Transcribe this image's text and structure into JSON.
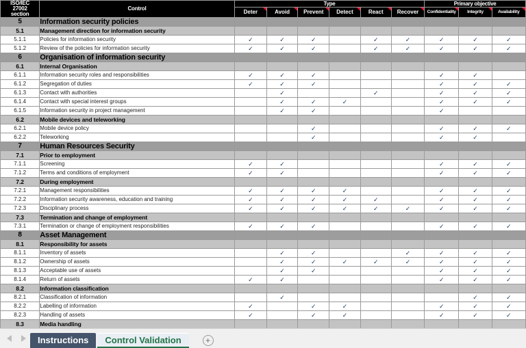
{
  "header": {
    "corner_lines": [
      "ISO/IEC",
      "27002",
      "section"
    ],
    "control_label": "Control",
    "type_label": "Type",
    "primary_objective_label": "Primary objective",
    "type_columns": [
      "Deter",
      "Avoid",
      "Prevent",
      "Detect",
      "React",
      "Recover"
    ],
    "objective_columns": [
      "Confidentiality",
      "Integrity",
      "Availability"
    ]
  },
  "checkmark_glyph": "✓",
  "colors": {
    "header_bg": "#000000",
    "header_text": "#ffffff",
    "level1_row_bg": "#9d9d9d",
    "level2_row_bg": "#c3c3c3",
    "item_row_bg": "#ffffff",
    "grid_line": "#9a9a9a",
    "comment_marker": "#e8112d",
    "active_tab_text": "#217346",
    "inactive_tab_bg": "#44546a"
  },
  "rows": [
    {
      "level": 1,
      "section": "5",
      "control": "Information security policies",
      "marks": [
        0,
        0,
        0,
        0,
        0,
        0,
        0,
        0,
        0
      ]
    },
    {
      "level": 2,
      "section": "5.1",
      "control": "Management direction for information security",
      "marks": [
        0,
        0,
        0,
        0,
        0,
        0,
        0,
        0,
        0
      ]
    },
    {
      "level": 3,
      "section": "5.1.1",
      "control": "Policies for information security",
      "marks": [
        1,
        1,
        1,
        0,
        1,
        1,
        1,
        1,
        1
      ]
    },
    {
      "level": 3,
      "section": "5.1.2",
      "control": "Review of the policies for information security",
      "marks": [
        1,
        1,
        1,
        0,
        1,
        1,
        1,
        1,
        1
      ]
    },
    {
      "level": 1,
      "section": "6",
      "control": "Organisation of information security",
      "marks": [
        0,
        0,
        0,
        0,
        0,
        0,
        0,
        0,
        0
      ]
    },
    {
      "level": 2,
      "section": "6.1",
      "control": "Internal Organisation",
      "marks": [
        0,
        0,
        0,
        0,
        0,
        0,
        0,
        0,
        0
      ]
    },
    {
      "level": 3,
      "section": "6.1.1",
      "control": "Information security roles and responsibilities",
      "marks": [
        1,
        1,
        1,
        0,
        0,
        0,
        1,
        1,
        0
      ]
    },
    {
      "level": 3,
      "section": "6.1.2",
      "control": "Segregation of duties",
      "marks": [
        1,
        1,
        1,
        0,
        0,
        0,
        1,
        1,
        1
      ]
    },
    {
      "level": 3,
      "section": "6.1.3",
      "control": "Contact with authorities",
      "marks": [
        0,
        1,
        0,
        0,
        1,
        0,
        1,
        1,
        1
      ]
    },
    {
      "level": 3,
      "section": "6.1.4",
      "control": "Contact with special interest groups",
      "marks": [
        0,
        1,
        1,
        1,
        0,
        0,
        1,
        1,
        1
      ]
    },
    {
      "level": 3,
      "section": "6.1.5",
      "control": "Information security in project management",
      "marks": [
        0,
        1,
        1,
        0,
        0,
        0,
        1,
        0,
        0
      ]
    },
    {
      "level": 2,
      "section": "6.2",
      "control": "Mobile devices and teleworking",
      "marks": [
        0,
        0,
        0,
        0,
        0,
        0,
        0,
        0,
        0
      ]
    },
    {
      "level": 3,
      "section": "6.2.1",
      "control": "Mobile device policy",
      "marks": [
        0,
        0,
        1,
        0,
        0,
        0,
        1,
        1,
        1
      ]
    },
    {
      "level": 3,
      "section": "6.2.2",
      "control": "Teleworking",
      "marks": [
        0,
        0,
        1,
        0,
        0,
        0,
        1,
        1,
        0
      ]
    },
    {
      "level": 1,
      "section": "7",
      "control": "Human Resources Security",
      "marks": [
        0,
        0,
        0,
        0,
        0,
        0,
        0,
        0,
        0
      ]
    },
    {
      "level": 2,
      "section": "7.1",
      "control": "Prior to employment",
      "marks": [
        0,
        0,
        0,
        0,
        0,
        0,
        0,
        0,
        0
      ]
    },
    {
      "level": 3,
      "section": "7.1.1",
      "control": "Screening",
      "marks": [
        1,
        1,
        0,
        0,
        0,
        0,
        1,
        1,
        1
      ]
    },
    {
      "level": 3,
      "section": "7.1.2",
      "control": "Terms and conditions of employment",
      "marks": [
        1,
        1,
        0,
        0,
        0,
        0,
        1,
        1,
        1
      ]
    },
    {
      "level": 2,
      "section": "7.2",
      "control": "During employment",
      "marks": [
        0,
        0,
        0,
        0,
        0,
        0,
        0,
        0,
        0
      ]
    },
    {
      "level": 3,
      "section": "7.2.1",
      "control": "Management responsibilities",
      "marks": [
        1,
        1,
        1,
        1,
        0,
        0,
        1,
        1,
        1
      ]
    },
    {
      "level": 3,
      "section": "7.2.2",
      "control": "Information security awareness, education and training",
      "marks": [
        1,
        1,
        1,
        1,
        1,
        0,
        1,
        1,
        1
      ]
    },
    {
      "level": 3,
      "section": "7.2.3",
      "control": "Disciplinary process",
      "marks": [
        1,
        1,
        1,
        1,
        1,
        1,
        1,
        1,
        1
      ]
    },
    {
      "level": 2,
      "section": "7.3",
      "control": "Termination and change of employment",
      "marks": [
        0,
        0,
        0,
        0,
        0,
        0,
        0,
        0,
        0
      ]
    },
    {
      "level": 3,
      "section": "7.3.1",
      "control": "Termination or change of employment responsibilities",
      "marks": [
        1,
        1,
        1,
        0,
        0,
        0,
        1,
        1,
        1
      ]
    },
    {
      "level": 1,
      "section": "8",
      "control": "Asset Management",
      "marks": [
        0,
        0,
        0,
        0,
        0,
        0,
        0,
        0,
        0
      ]
    },
    {
      "level": 2,
      "section": "8.1",
      "control": "Responsibility for assets",
      "marks": [
        0,
        0,
        0,
        0,
        0,
        0,
        0,
        0,
        0
      ]
    },
    {
      "level": 3,
      "section": "8.1.1",
      "control": "Inventory of assets",
      "marks": [
        0,
        1,
        1,
        0,
        0,
        1,
        1,
        1,
        1
      ]
    },
    {
      "level": 3,
      "section": "8.1.2",
      "control": "Ownership of assets",
      "marks": [
        0,
        1,
        1,
        1,
        1,
        1,
        1,
        1,
        1
      ]
    },
    {
      "level": 3,
      "section": "8.1.3",
      "control": "Acceptable use of assets",
      "marks": [
        0,
        1,
        1,
        0,
        0,
        0,
        1,
        1,
        1
      ]
    },
    {
      "level": 3,
      "section": "8.1.4",
      "control": "Return of assets",
      "marks": [
        1,
        1,
        0,
        0,
        0,
        0,
        1,
        1,
        1
      ]
    },
    {
      "level": 2,
      "section": "8.2",
      "control": "Information classification",
      "marks": [
        0,
        0,
        0,
        0,
        0,
        0,
        0,
        0,
        0
      ]
    },
    {
      "level": 3,
      "section": "8.2.1",
      "control": "Classification of information",
      "marks": [
        0,
        1,
        0,
        0,
        0,
        0,
        0,
        1,
        1
      ]
    },
    {
      "level": 3,
      "section": "8.2.2",
      "control": "Labelling of information",
      "marks": [
        1,
        0,
        1,
        1,
        0,
        0,
        1,
        1,
        1
      ]
    },
    {
      "level": 3,
      "section": "8.2.3",
      "control": "Handling of assets",
      "marks": [
        1,
        0,
        1,
        1,
        0,
        0,
        1,
        1,
        1
      ]
    },
    {
      "level": 2,
      "section": "8.3",
      "control": "Media handling",
      "marks": [
        0,
        0,
        0,
        0,
        0,
        0,
        0,
        0,
        0
      ]
    }
  ],
  "tabbar": {
    "tabs": [
      {
        "label": "Instructions",
        "active": false
      },
      {
        "label": "Control Validation",
        "active": true
      }
    ],
    "add_sheet_glyph": "+",
    "prev_arrow": "prev-sheet",
    "next_arrow": "next-sheet"
  }
}
